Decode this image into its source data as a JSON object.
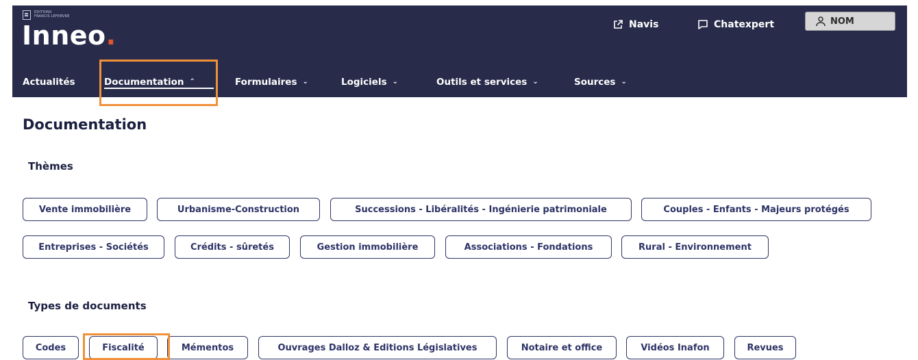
{
  "header": {
    "brand_line1": "EDITIONS",
    "brand_line2": "FRANCIS LEFEBVRE",
    "logo_text": "Inneo",
    "logo_dot": ".",
    "links": [
      {
        "label": "Navis",
        "icon": "external-link-icon"
      },
      {
        "label": "Chatexpert",
        "icon": "chat-bubble-icon"
      }
    ],
    "profile": {
      "label": "NOM",
      "icon": "user-icon"
    }
  },
  "nav": {
    "items": [
      {
        "label": "Actualités",
        "chevron": ""
      },
      {
        "label": "Documentation",
        "chevron": "⌃"
      },
      {
        "label": "Formulaires",
        "chevron": "⌄"
      },
      {
        "label": "Logiciels",
        "chevron": "⌄"
      },
      {
        "label": "Outils et services",
        "chevron": "⌄"
      },
      {
        "label": "Sources",
        "chevron": "⌄"
      }
    ]
  },
  "main": {
    "title": "Documentation",
    "themes": {
      "title": "Thèmes",
      "items": [
        "Vente immobilière",
        "Urbanisme-Construction",
        "Successions - Libéralités - Ingénierie patrimoniale",
        "Couples - Enfants - Majeurs protégés",
        "Entreprises - Sociétés",
        "Crédits - sûretés",
        "Gestion immobilière",
        "Associations - Fondations",
        "Rural - Environnement"
      ]
    },
    "types": {
      "title": "Types de documents",
      "items": [
        "Codes",
        "Fiscalité",
        "Mémentos",
        "Ouvrages Dalloz & Editions Législatives",
        "Notaire et office",
        "Vidéos Inafon",
        "Revues"
      ]
    }
  },
  "colors": {
    "header_bg": "#282c4a",
    "accent_orange": "#f0913a",
    "chip_border": "#2d3366",
    "logo_dot": "#e0552f"
  }
}
